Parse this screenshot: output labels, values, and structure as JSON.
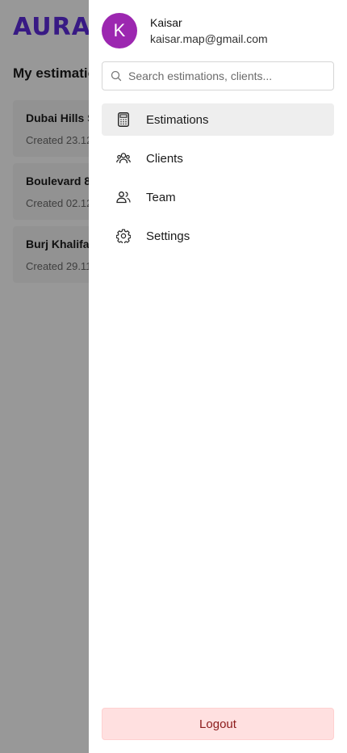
{
  "background": {
    "logo": "AURA",
    "heading": "My estimations",
    "cards": [
      {
        "title": "Dubai Hills S",
        "subtitle": "Created 23.12"
      },
      {
        "title": "Boulevard 8",
        "subtitle": "Created 02.12"
      },
      {
        "title": "Burj Khalifa",
        "subtitle": "Created 29.11"
      }
    ]
  },
  "drawer": {
    "profile": {
      "initial": "K",
      "name": "Kaisar",
      "email": "kaisar.map@gmail.com",
      "avatar_color": "#9c27b0"
    },
    "search": {
      "placeholder": "Search estimations, clients...",
      "value": ""
    },
    "nav": [
      {
        "label": "Estimations",
        "icon": "calculator-icon",
        "active": true
      },
      {
        "label": "Clients",
        "icon": "users-group-icon",
        "active": false
      },
      {
        "label": "Team",
        "icon": "team-icon",
        "active": false
      },
      {
        "label": "Settings",
        "icon": "gear-icon",
        "active": false
      }
    ],
    "logout_label": "Logout"
  },
  "colors": {
    "brand": "#5b2bd6",
    "active_item_bg": "#eeeeee",
    "logout_bg": "#ffe0e0",
    "logout_text": "#8b1a1a"
  }
}
